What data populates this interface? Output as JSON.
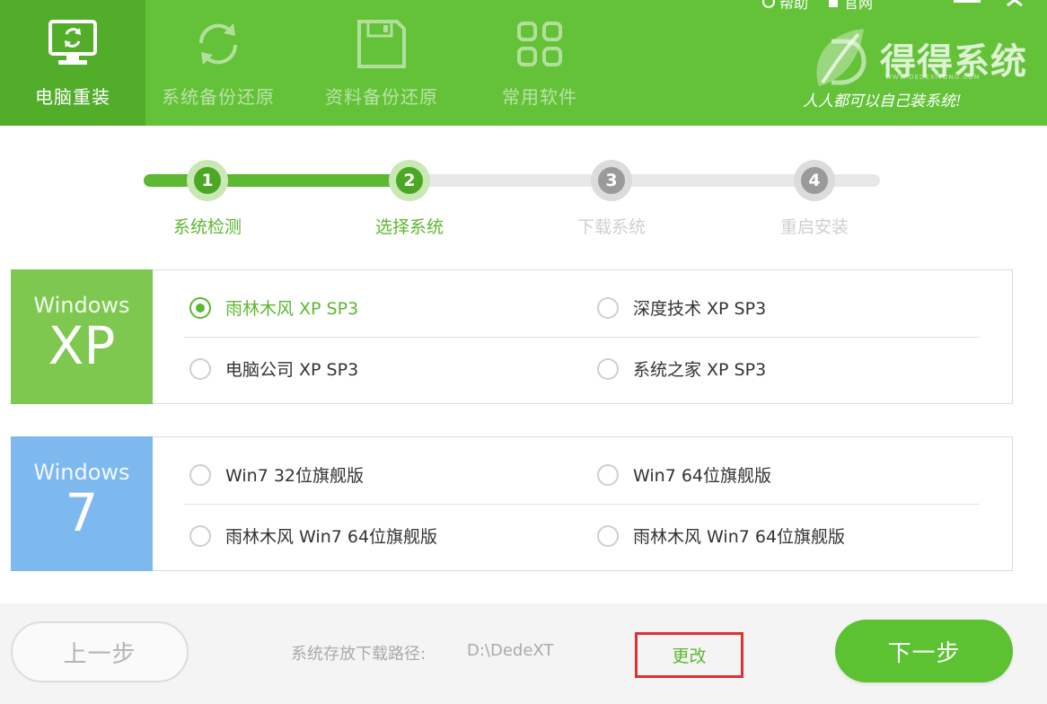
{
  "header": {
    "tabs": [
      {
        "label": "电脑重装",
        "icon": "monitor-refresh-icon",
        "active": true
      },
      {
        "label": "系统备份还原",
        "icon": "sync-icon",
        "active": false
      },
      {
        "label": "资料备份还原",
        "icon": "floppy-disk-icon",
        "active": false
      },
      {
        "label": "常用软件",
        "icon": "app-grid-icon",
        "active": false
      }
    ],
    "top_links": {
      "help": "帮助",
      "website": "官网"
    },
    "brand": {
      "name": "得得系统",
      "url": "WWW.DEDEXITONG.COM",
      "slogan": "人人都可以自己装系统!"
    }
  },
  "steps": [
    {
      "number": "1",
      "label": "系统检测",
      "state": "done"
    },
    {
      "number": "2",
      "label": "选择系统",
      "state": "done"
    },
    {
      "number": "3",
      "label": "下载系统",
      "state": "todo"
    },
    {
      "number": "4",
      "label": "重启安装",
      "state": "todo"
    }
  ],
  "os_groups": [
    {
      "brand": "Windows",
      "version": "XP",
      "color": "#7ec850",
      "options": [
        {
          "label": "雨林木风 XP SP3",
          "selected": true
        },
        {
          "label": "深度技术 XP SP3",
          "selected": false
        },
        {
          "label": "电脑公司 XP SP3",
          "selected": false
        },
        {
          "label": "系统之家 XP SP3",
          "selected": false
        }
      ]
    },
    {
      "brand": "Windows",
      "version": "7",
      "color": "#7db9ef",
      "options": [
        {
          "label": "Win7 32位旗舰版",
          "selected": false
        },
        {
          "label": "Win7 64位旗舰版",
          "selected": false
        },
        {
          "label": "雨林木风 Win7 64位旗舰版",
          "selected": false
        },
        {
          "label": "雨林木风 Win7 64位旗舰版",
          "selected": false
        }
      ]
    }
  ],
  "footer": {
    "prev_label": "上一步",
    "path_label": "系统存放下载路径:",
    "path_value": "D:\\DedeXT",
    "change_label": "更改",
    "next_label": "下一步"
  },
  "colors": {
    "header": "#64c239",
    "accent": "#5cb731",
    "highlight_border": "#e03030"
  }
}
